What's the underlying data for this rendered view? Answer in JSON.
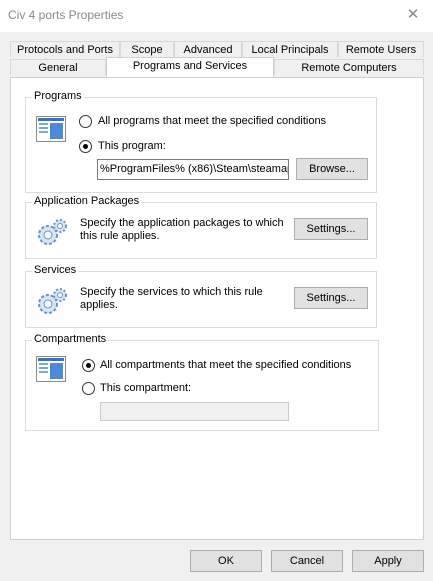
{
  "window": {
    "title": "Civ 4 ports Properties"
  },
  "tabs": {
    "row1": [
      "Protocols and Ports",
      "Scope",
      "Advanced",
      "Local Principals",
      "Remote Users"
    ],
    "row2": [
      "General",
      "Programs and Services",
      "Remote Computers"
    ],
    "active": "Programs and Services"
  },
  "programs": {
    "label": "Programs",
    "option_all": "All programs that meet the specified conditions",
    "option_this": "This program:",
    "selected": "This program:",
    "path_value": "%ProgramFiles% (x86)\\Steam\\steamap",
    "browse_label": "Browse..."
  },
  "app_packages": {
    "label": "Application Packages",
    "description_line1": "Specify the application packages to which",
    "description_line2": "this rule applies.",
    "settings_label": "Settings..."
  },
  "services": {
    "label": "Services",
    "description_line1": "Specify the services to which this rule",
    "description_line2": "applies.",
    "settings_label": "Settings..."
  },
  "compartments": {
    "label": "Compartments",
    "option_all": "All compartments that meet the specified conditions",
    "option_this": "This compartment:",
    "selected": "All compartments that meet the specified conditions",
    "field_value": ""
  },
  "buttons": {
    "ok": "OK",
    "cancel": "Cancel",
    "apply": "Apply"
  }
}
